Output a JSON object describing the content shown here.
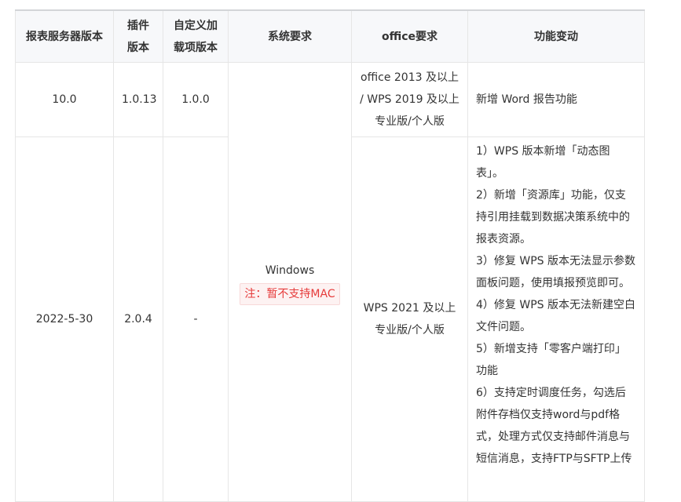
{
  "headers": {
    "server_version": "报表服务器版本",
    "plugin_version_1": "插件",
    "plugin_version_2": "版本",
    "custom_addon_1": "自定义加",
    "custom_addon_2": "载项版本",
    "system": "系统要求",
    "office": "office要求",
    "changes": "功能变动"
  },
  "rows": [
    {
      "server_version": "10.0",
      "plugin_version": "1.0.13",
      "custom_addon": "1.0.0",
      "office": "office 2013 及以上 / WPS 2019 及以上 专业版/个人版",
      "changes": [
        "新增 Word 报告功能"
      ]
    },
    {
      "server_version": "2022-5-30",
      "plugin_version": "2.0.4",
      "custom_addon": "-",
      "office": "WPS 2021 及以上 专业版/个人版",
      "changes": [
        "1）WPS 版本新增「动态图表」。",
        "2）新增「资源库」功能，仅支持引用挂载到数据决策系统中的报表资源。",
        "3）修复 WPS 版本无法显示参数面板问题，使用填报预览即可。",
        "4）修复 WPS 版本无法新建空白文件问题。",
        "5）新增支持「零客户端打印」功能",
        "6）支持定时调度任务，勾选后附件存档仅支持word与pdf格式，处理方式仅支持邮件消息与短信消息，支持FTP与SFTP上传"
      ]
    }
  ],
  "system": {
    "os": "Windows",
    "note": "注：暂不支持MAC"
  },
  "colors": {
    "header_bg": "#f7f8fa",
    "border": "#e6e6e6",
    "warning_text": "#e63b3b",
    "warning_bg": "#fdf2f2"
  }
}
